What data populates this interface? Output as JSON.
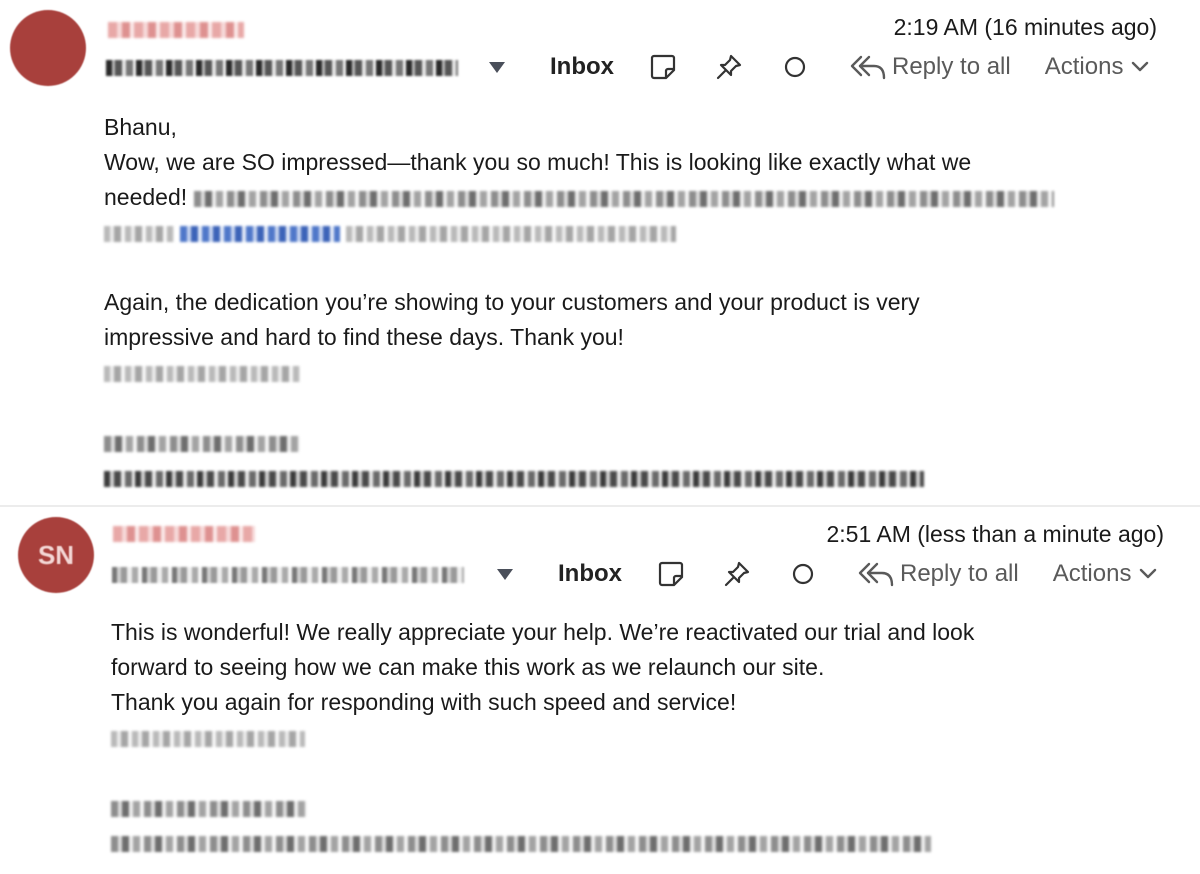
{
  "messages": [
    {
      "avatar_initials": "",
      "timestamp": "2:19 AM (16 minutes ago)",
      "folder_label": "Inbox",
      "reply_all_label": "Reply to all",
      "actions_label": "Actions",
      "body": {
        "greeting": "Bhanu,",
        "line1": "Wow, we are SO impressed—thank you so much! This is looking like exactly what we",
        "line2_start": "needed!",
        "para2_line1": "Again, the dedication you’re showing to your customers and your product is very",
        "para2_line2": "impressive and hard to find these days. Thank you!"
      }
    },
    {
      "avatar_initials": "SN",
      "timestamp": "2:51 AM (less than a minute ago)",
      "folder_label": "Inbox",
      "reply_all_label": "Reply to all",
      "actions_label": "Actions",
      "body": {
        "line1": "This is wonderful! We really appreciate your help. We’re reactivated our trial and look",
        "line2": "forward to seeing how we can make this work as we relaunch our site.",
        "line3": "Thank you again for responding with such speed and service!"
      }
    }
  ],
  "icons": {
    "dropdown": "caret-down-icon",
    "note": "sticky-note-icon",
    "pin": "pin-icon",
    "read_status": "circle-icon",
    "reply_all": "reply-all-icon",
    "chevron": "chevron-down-icon"
  },
  "colors": {
    "avatar": "#a8403c",
    "toolbar_text": "#5a5a5a",
    "body_text": "#1a1a1a"
  }
}
